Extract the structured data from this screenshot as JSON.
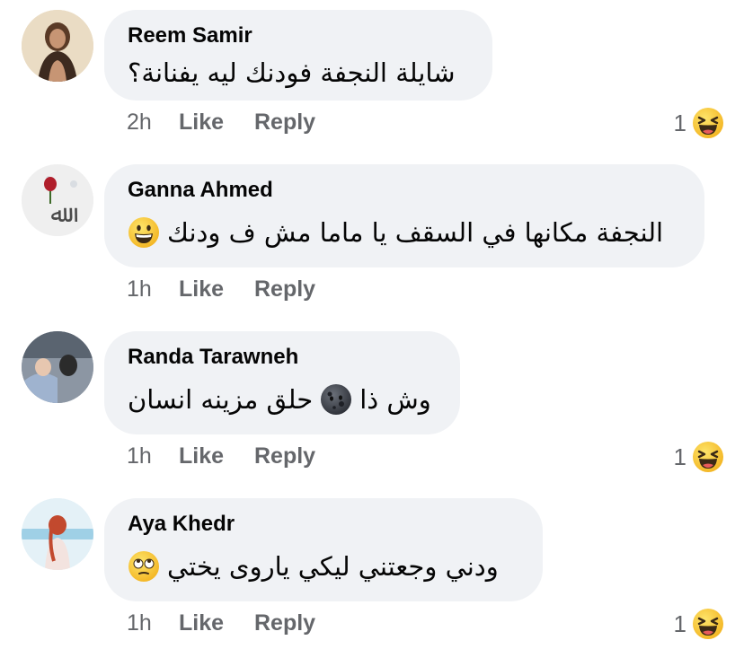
{
  "comments": [
    {
      "author": "Reem Samir",
      "text": "شايلة النجفة فودنك ليه يفنانة؟",
      "time": "2h",
      "like_label": "Like",
      "reply_label": "Reply",
      "reaction_count": "1",
      "reaction_icon": "laughing-face-icon",
      "inline_emoji": ""
    },
    {
      "author": "Ganna Ahmed",
      "text": "النجفة  مكانها في السقف يا ماما مش ف ودنك",
      "time": "1h",
      "like_label": "Like",
      "reply_label": "Reply",
      "reaction_count": "",
      "inline_emoji": "grinning-face-icon"
    },
    {
      "author": "Randa Tarawneh",
      "text_before": "وش ذا",
      "text_after": "حلق مزينه انسان",
      "time": "1h",
      "like_label": "Like",
      "reply_label": "Reply",
      "reaction_count": "1",
      "reaction_icon": "laughing-face-icon",
      "inline_emoji": "new-moon-face-icon"
    },
    {
      "author": "Aya Khedr",
      "text": "ودني وجعتني ليكي ياروى يختي",
      "time": "1h",
      "like_label": "Like",
      "reply_label": "Reply",
      "reaction_count": "1",
      "reaction_icon": "laughing-face-icon",
      "inline_emoji": "rolling-eyes-face-icon"
    }
  ],
  "colors": {
    "bubble": "#f0f2f5",
    "meta_text": "#65676b",
    "emoji_yellow": "#f7b928"
  }
}
